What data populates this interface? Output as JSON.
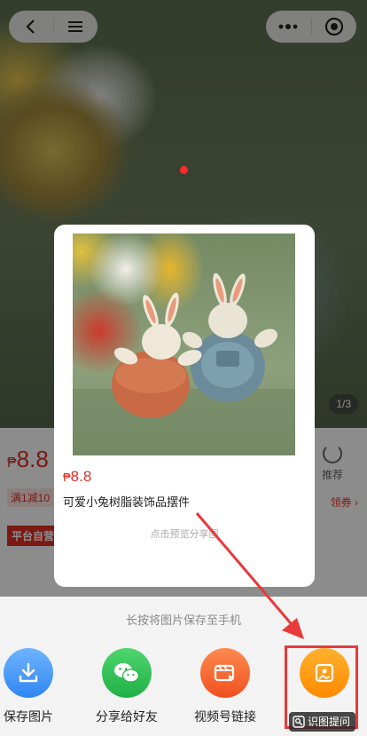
{
  "hero": {
    "counter": "1/3"
  },
  "product": {
    "price_currency": "₱",
    "price_value": "8.8",
    "coupon": "满1减10",
    "platform_tag": "平台自营",
    "recommend_label": "推荐",
    "claim_label": "领券 ›"
  },
  "card": {
    "price_currency": "₱",
    "price_value": "8.8",
    "title": "可爱小兔树脂装饰品摆件",
    "preview_tip": "点击预览分享图"
  },
  "sheet": {
    "hint": "长按将图片保存至手机",
    "actions": [
      {
        "label": "保存图片",
        "icon": "download-icon"
      },
      {
        "label": "分享给好友",
        "icon": "wechat-icon"
      },
      {
        "label": "视频号链接",
        "icon": "video-channel-icon"
      },
      {
        "label": "",
        "icon": "image-icon"
      }
    ]
  },
  "ocr_badge": {
    "label": "识图提问",
    "icon": "image-search-icon"
  },
  "colors": {
    "price_red": "#e02e24",
    "annotation_red": "#e8393b"
  }
}
